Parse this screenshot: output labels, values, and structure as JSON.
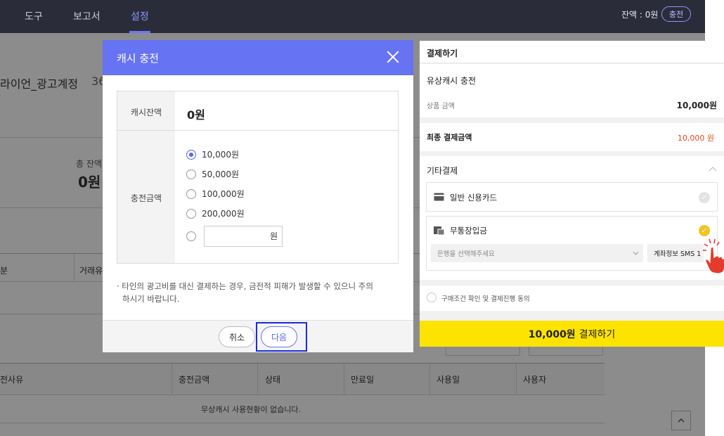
{
  "nav": {
    "items": [
      "도구",
      "보고서",
      "설정"
    ],
    "active_index": 2,
    "balance": "잔액 : 0원",
    "charge_label": "충전"
  },
  "background": {
    "account_title": "라이언_광고계정",
    "account_id_partial": "36",
    "total_balance_label": "총 잔액",
    "total_balance_value": "0원",
    "col_division": "분",
    "col_transaction": "거래유",
    "table_headers": [
      "전사유",
      "충전금액",
      "상태",
      "만료일",
      "사용일",
      "사용자"
    ],
    "empty_message": "무상캐시 사용현황이 없습니다.",
    "scroll_top_icon": "chevron-up-icon"
  },
  "modal": {
    "title": "캐시 충전",
    "balance_label": "캐시잔액",
    "balance_value": "0원",
    "amount_label": "충전금액",
    "options": [
      "10,000원",
      "50,000원",
      "100,000원",
      "200,000원"
    ],
    "selected_option_index": 0,
    "custom_unit": "원",
    "notice_line1": "· 타인의 광고비를 대신 결제하는 경우, 금전적 피해가 발생할 수 있으니 주의",
    "notice_line2": "하시기 바랍니다.",
    "cancel_label": "취소",
    "next_label": "다음"
  },
  "payment": {
    "title": "결제하기",
    "product_name": "유상캐시 충전",
    "product_amount_label": "상품 금액",
    "product_amount": "10,000원",
    "final_label": "최종 결제금액",
    "final_amount": "10,000 원",
    "other_payment_label": "기타결제",
    "method_card": "일반 신용카드",
    "method_bank": "무통장입금",
    "bank_select_placeholder": "은행을 선택해주세요",
    "account_sms": "계좌정보 SMS 1",
    "agree_label": "구매조건 확인 및 결제진행 동의",
    "pay_amount": "10,000원",
    "pay_label": "결제하기",
    "colors": {
      "pay_button": "#fde400",
      "final_amount": "#e8431c",
      "check_selected": "#f3c322"
    }
  }
}
